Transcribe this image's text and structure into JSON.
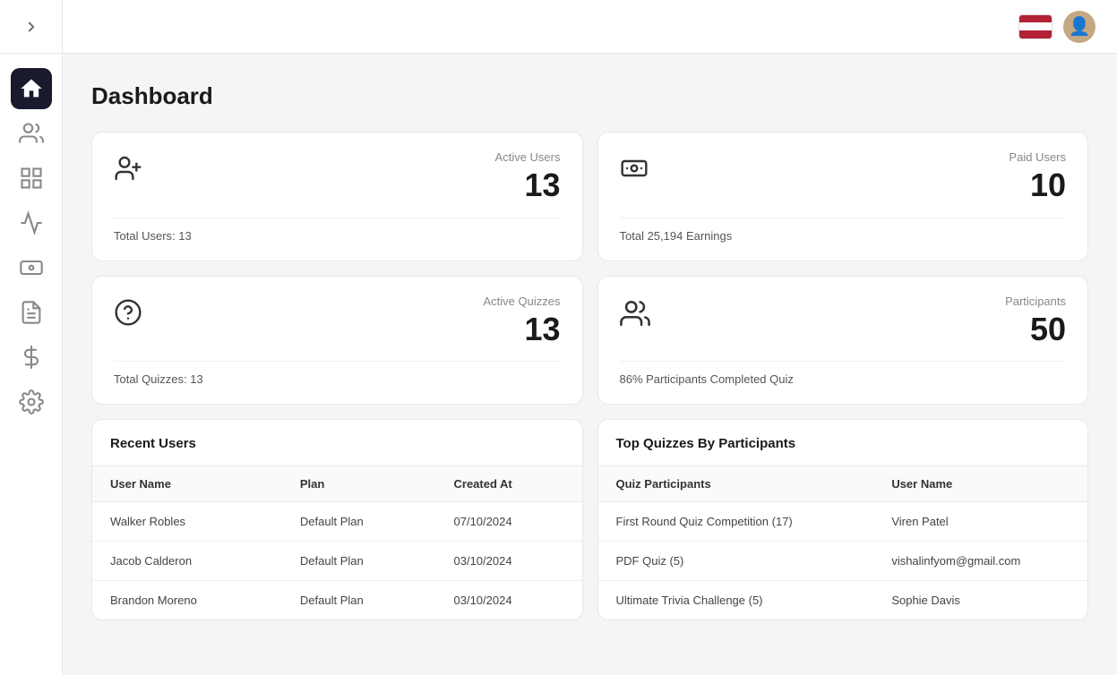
{
  "sidebar": {
    "items": [
      {
        "id": "home",
        "label": "Home",
        "active": true
      },
      {
        "id": "users",
        "label": "Users",
        "active": false
      },
      {
        "id": "grid",
        "label": "Grid",
        "active": false
      },
      {
        "id": "reports",
        "label": "Reports",
        "active": false
      },
      {
        "id": "earnings",
        "label": "Earnings",
        "active": false
      },
      {
        "id": "quizzes",
        "label": "Quizzes",
        "active": false
      },
      {
        "id": "dollar",
        "label": "Dollar",
        "active": false
      },
      {
        "id": "settings",
        "label": "Settings",
        "active": false
      }
    ]
  },
  "page": {
    "title": "Dashboard"
  },
  "stats": [
    {
      "id": "active-users",
      "label": "Active Users",
      "value": "13",
      "footer": "Total Users: 13",
      "icon": "user-plus"
    },
    {
      "id": "paid-users",
      "label": "Paid Users",
      "value": "10",
      "footer": "Total 25,194 Earnings",
      "icon": "cash"
    },
    {
      "id": "active-quizzes",
      "label": "Active Quizzes",
      "value": "13",
      "footer": "Total Quizzes: 13",
      "icon": "question"
    },
    {
      "id": "participants",
      "label": "Participants",
      "value": "50",
      "footer": "86% Participants Completed Quiz",
      "icon": "group"
    }
  ],
  "recent_users": {
    "title": "Recent Users",
    "columns": [
      "User Name",
      "Plan",
      "Created At"
    ],
    "rows": [
      {
        "name": "Walker Robles",
        "plan": "Default Plan",
        "created_at": "07/10/2024"
      },
      {
        "name": "Jacob Calderon",
        "plan": "Default Plan",
        "created_at": "03/10/2024"
      },
      {
        "name": "Brandon Moreno",
        "plan": "Default Plan",
        "created_at": "03/10/2024"
      }
    ]
  },
  "top_quizzes": {
    "title": "Top Quizzes By Participants",
    "columns": [
      "Quiz Participants",
      "User Name"
    ],
    "rows": [
      {
        "quiz": "First Round Quiz Competition (17)",
        "user": "Viren Patel"
      },
      {
        "quiz": "PDF Quiz (5)",
        "user": "vishalinfyom@gmail.com"
      },
      {
        "quiz": "Ultimate Trivia Challenge (5)",
        "user": "Sophie Davis"
      }
    ]
  }
}
